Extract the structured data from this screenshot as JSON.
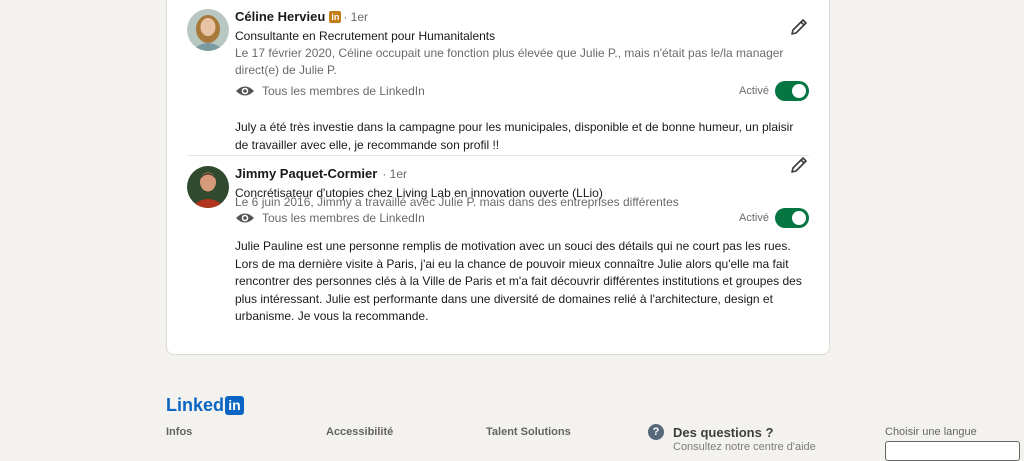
{
  "recommendations": [
    {
      "name": "Céline Hervieu",
      "premium_badge": "in",
      "degree": "· 1er",
      "headline": "Consultante en Recrutement pour Humanitalents",
      "relation": "Le 17 février 2020, Céline occupait une fonction plus élevée que Julie P., mais n'était pas le/la manager direct(e) de Julie P.",
      "visibility": "Tous les membres de LinkedIn",
      "toggle_label": "Activé",
      "toggle_on": true,
      "text": "July a été très investie dans la campagne pour les municipales, disponible et de bonne humeur, un plaisir de travailler avec elle, je recommande son profil !!"
    },
    {
      "name": "Jimmy Paquet-Cormier",
      "degree": "· 1er",
      "headline": "Concrétisateur d'utopies chez Living Lab en innovation ouverte (LLio)",
      "relation": "Le 6 juin 2016, Jimmy a travaillé avec Julie P. mais dans des entreprises différentes",
      "visibility": "Tous les membres de LinkedIn",
      "toggle_label": "Activé",
      "toggle_on": true,
      "text": "Julie Pauline est une personne remplis de motivation avec un souci des détails qui ne court pas les rues. Lors de ma dernière visite à Paris, j'ai eu la chance de pouvoir mieux connaître Julie alors qu'elle ma fait rencontrer des personnes clés à la Ville de Paris et m'a fait découvrir différentes institutions et groupes des plus intéressant. Julie est performante dans une diversité de domaines relié à l'architecture, design et urbanisme. Je vous la recommande."
    }
  ],
  "footer": {
    "logo_text": "Linked",
    "logo_in": "in",
    "columns": [
      "Infos",
      "Accessibilité",
      "Talent Solutions"
    ],
    "help_title": "Des questions ?",
    "help_sub": "Consultez notre centre d'aide",
    "language_label": "Choisir une langue"
  },
  "colors": {
    "brand": "#0a66c2",
    "toggle_on": "#057642",
    "premium_badge": "#c37d16"
  }
}
